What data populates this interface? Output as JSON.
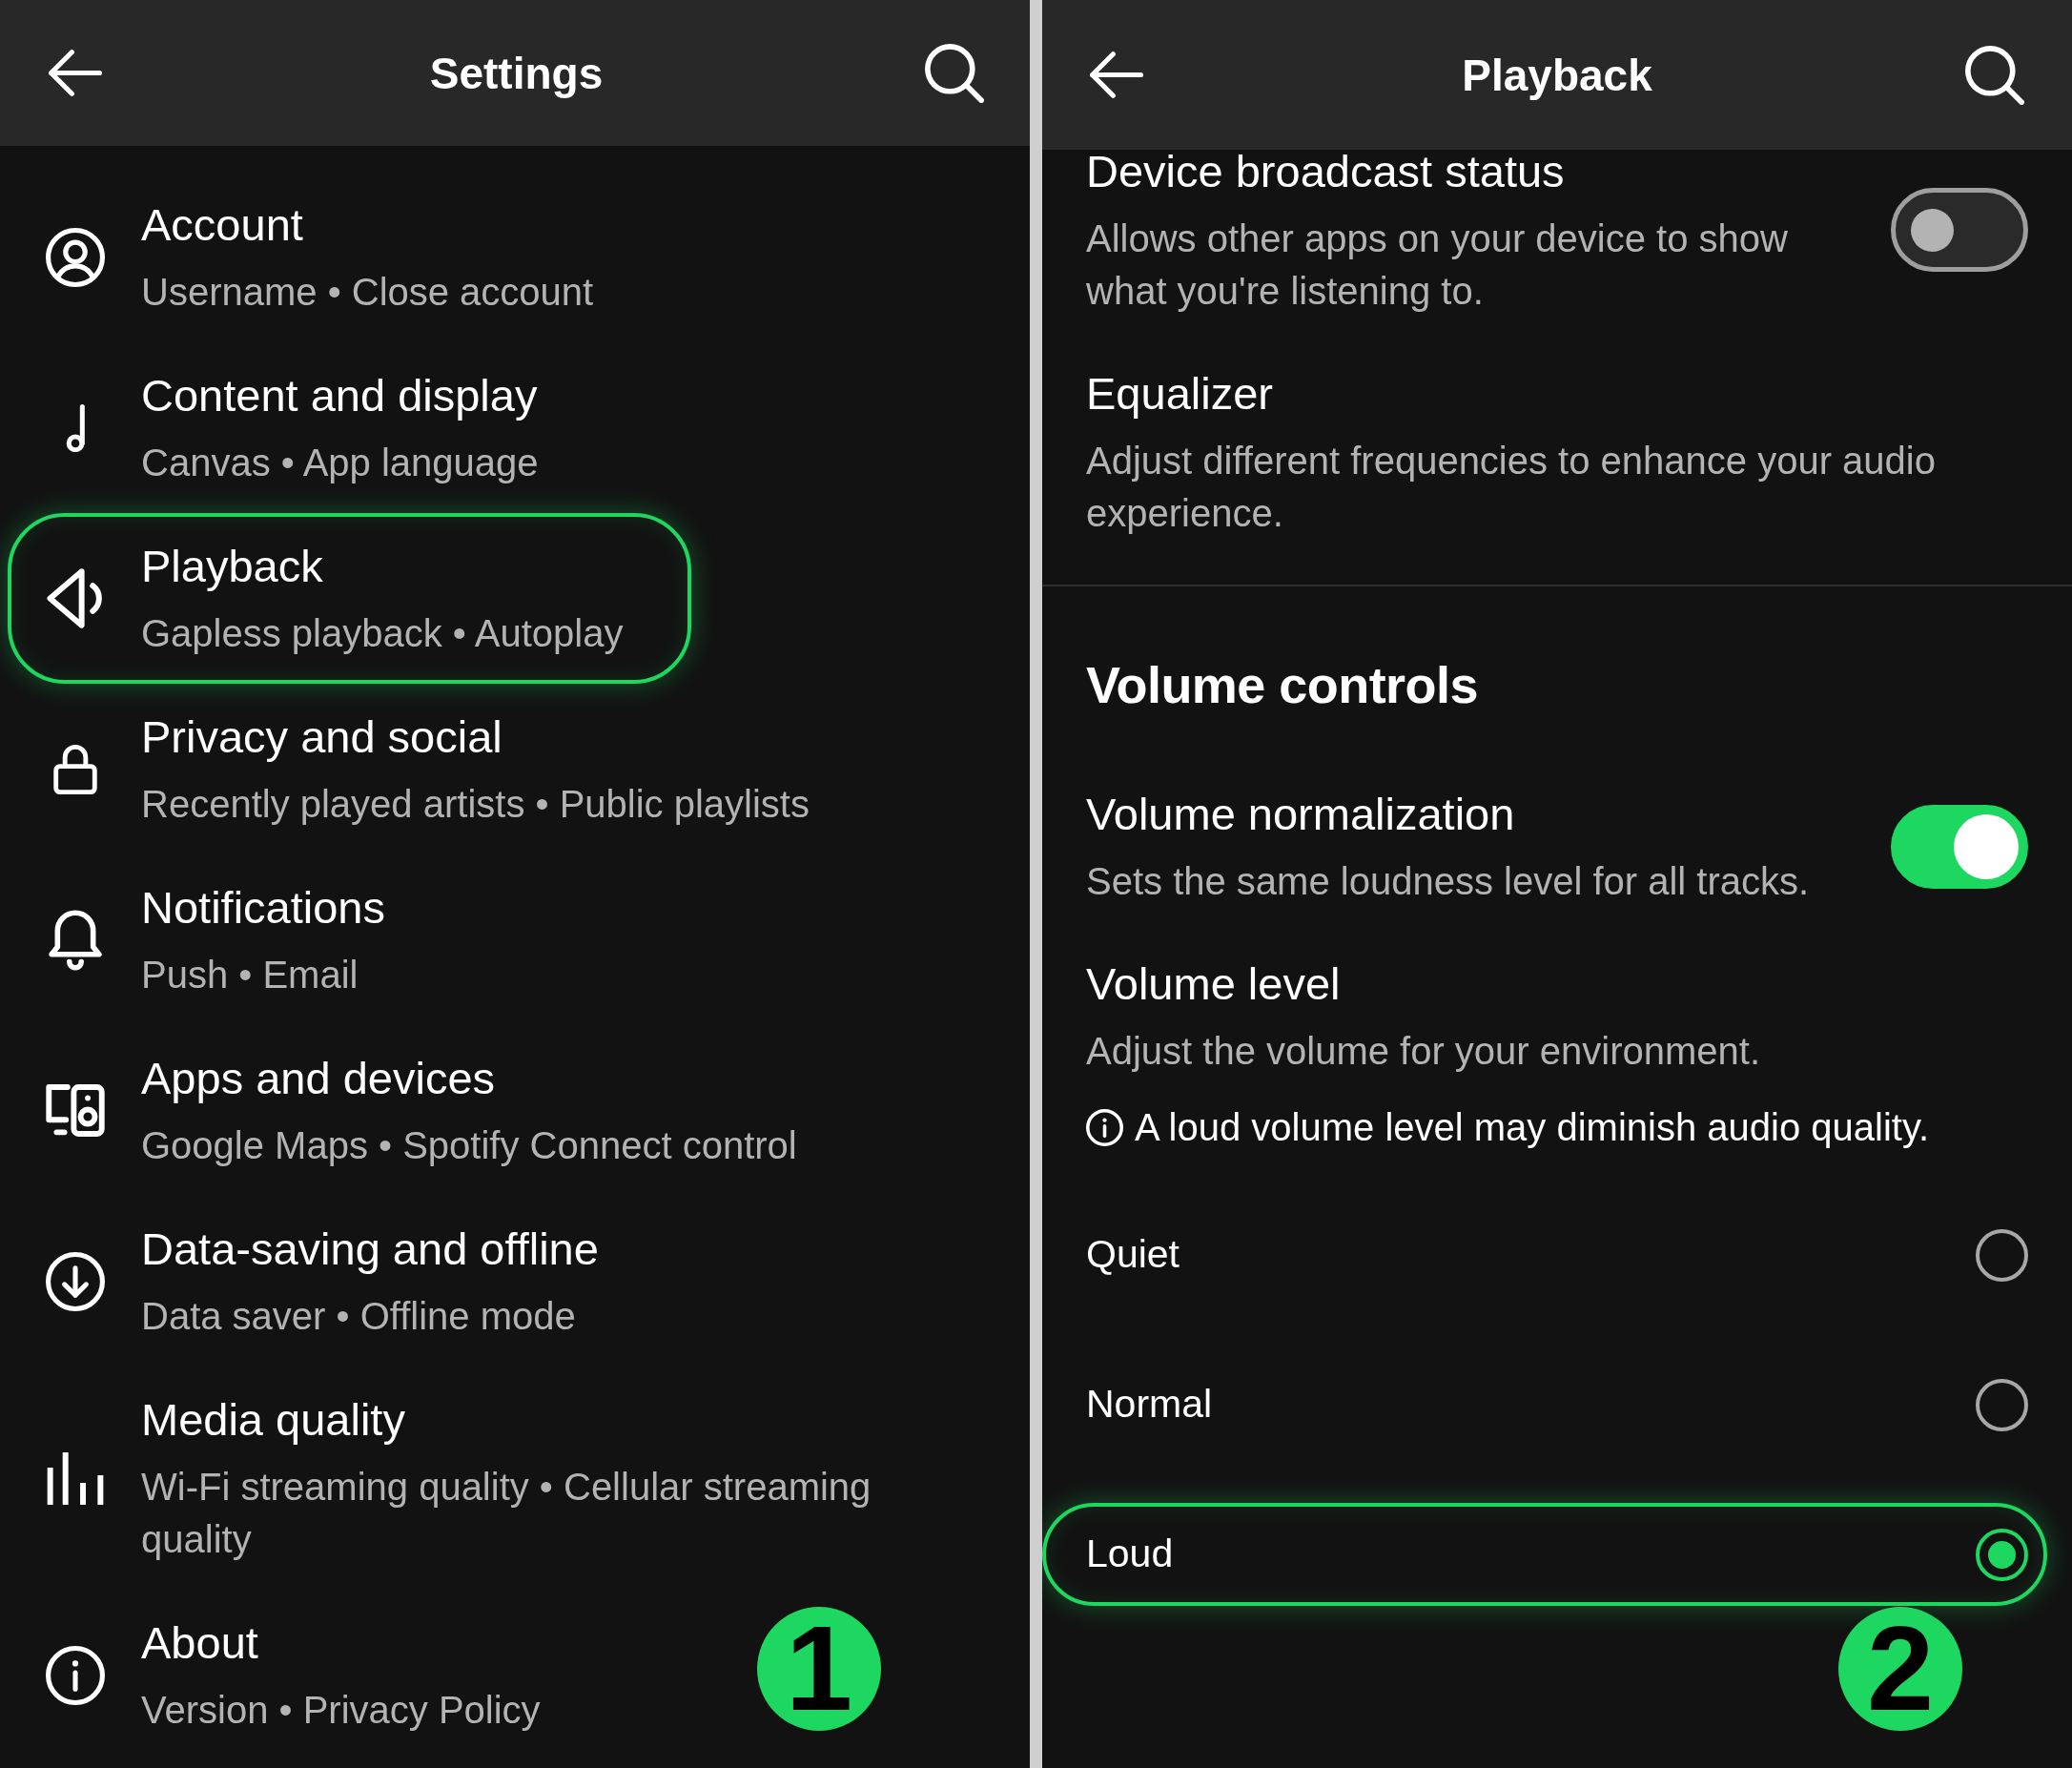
{
  "settings_screen": {
    "header": {
      "title": "Settings"
    },
    "items": [
      {
        "title": "Account",
        "subtitle": "Username • Close account",
        "highlighted": false
      },
      {
        "title": "Content and display",
        "subtitle": "Canvas • App language",
        "highlighted": false
      },
      {
        "title": "Playback",
        "subtitle": "Gapless playback • Autoplay",
        "highlighted": true
      },
      {
        "title": "Privacy and social",
        "subtitle": "Recently played artists • Public playlists",
        "highlighted": false
      },
      {
        "title": "Notifications",
        "subtitle": "Push • Email",
        "highlighted": false
      },
      {
        "title": "Apps and devices",
        "subtitle": "Google Maps • Spotify Connect control",
        "highlighted": false
      },
      {
        "title": "Data-saving and offline",
        "subtitle": "Data saver • Offline mode",
        "highlighted": false
      },
      {
        "title": "Media quality",
        "subtitle": "Wi-Fi streaming quality • Cellular streaming quality",
        "highlighted": false
      },
      {
        "title": "About",
        "subtitle": "Version • Privacy Policy",
        "highlighted": false
      }
    ],
    "step_badge": "1"
  },
  "playback_screen": {
    "header": {
      "title": "Playback"
    },
    "rows": [
      {
        "kind": "toggle",
        "title": "Device broadcast status",
        "description": "Allows other apps on your device to show what you're listening to.",
        "on": false
      },
      {
        "kind": "plain",
        "title": "Equalizer",
        "description": "Adjust different frequencies to enhance your audio experience."
      }
    ],
    "volume_controls": {
      "heading": "Volume controls",
      "rows": [
        {
          "kind": "toggle",
          "title": "Volume normalization",
          "description": "Sets the same loudness level for all tracks.",
          "on": true
        },
        {
          "kind": "choice",
          "title": "Volume level",
          "description": "Adjust the volume for your environment.",
          "note": "A loud volume level may diminish audio quality.",
          "options": [
            {
              "label": "Quiet",
              "selected": false,
              "highlighted": false
            },
            {
              "label": "Normal",
              "selected": false,
              "highlighted": false
            },
            {
              "label": "Loud",
              "selected": true,
              "highlighted": true
            }
          ]
        }
      ]
    },
    "step_badge": "2"
  }
}
